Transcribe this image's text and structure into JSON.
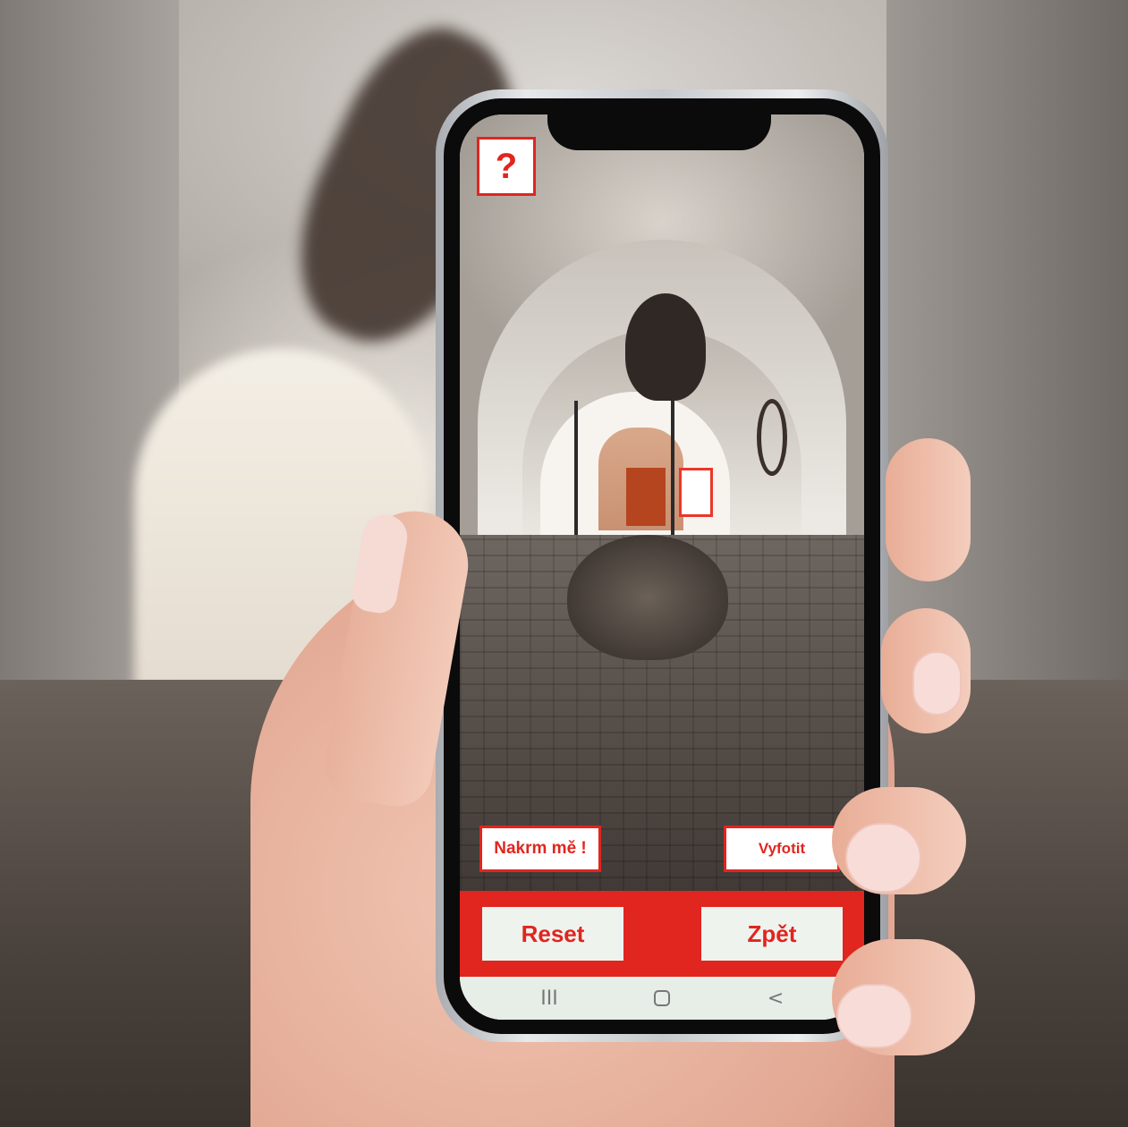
{
  "app": {
    "help_label": "?",
    "feed_label": "Nakrm mě !",
    "photo_label": "Vyfotit",
    "reset_label": "Reset",
    "back_label": "Zpět"
  },
  "system_nav": {
    "recent_icon": "recent-apps-icon",
    "home_icon": "home-icon",
    "back_icon": "back-icon",
    "recent_glyph": "III",
    "back_glyph": "<"
  },
  "colors": {
    "accent": "#e1251f",
    "button_bg": "#eef3ee",
    "nav_bg": "#e6eee7"
  }
}
